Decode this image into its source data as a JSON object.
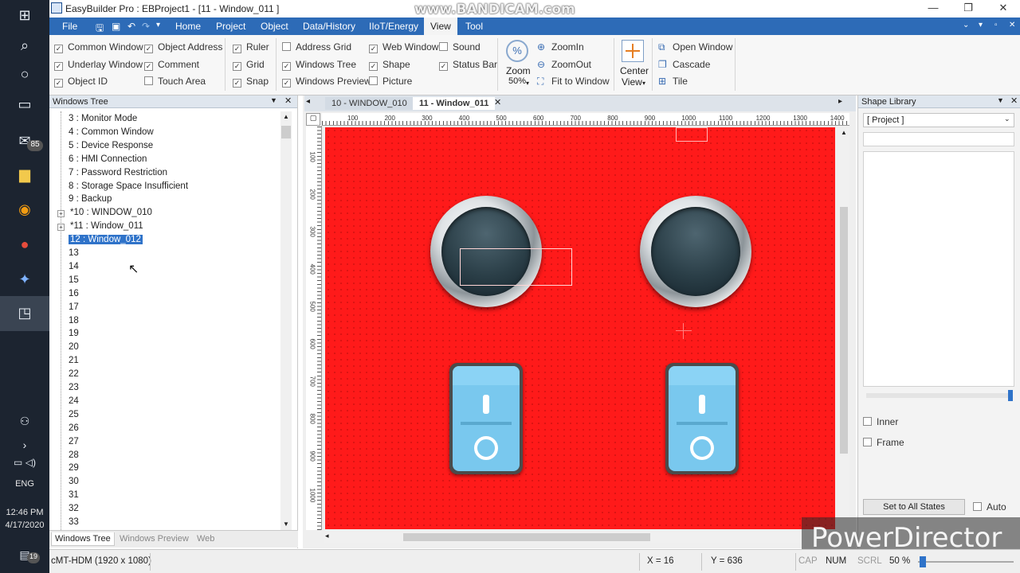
{
  "window": {
    "title": "EasyBuilder Pro : EBProject1 - [11 - Window_011 ]",
    "controls": [
      "—",
      "❐",
      "✕"
    ]
  },
  "watermarks": {
    "top": "www.BANDICAM.com",
    "bottom": "PowerDirector"
  },
  "taskbar": {
    "mail_badge": "85",
    "notif_badge": "19",
    "language": "ENG",
    "time": "12:46 PM",
    "date": "4/17/2020"
  },
  "menubar": {
    "items": [
      "File",
      "Home",
      "Project",
      "Object",
      "Data/History",
      "IIoT/Energy",
      "View",
      "Tool"
    ],
    "active": "View",
    "right_controls": [
      "⌄",
      "▾",
      "▫",
      "✕"
    ]
  },
  "ribbon": {
    "group1": [
      {
        "label": "Common Window",
        "checked": true
      },
      {
        "label": "Underlay Window",
        "checked": true
      },
      {
        "label": "Object ID",
        "checked": true
      },
      {
        "label": "Object Address",
        "checked": true
      },
      {
        "label": "Comment",
        "checked": true
      },
      {
        "label": "Touch Area",
        "checked": false
      }
    ],
    "group2": [
      {
        "label": "Ruler",
        "checked": true
      },
      {
        "label": "Grid",
        "checked": true
      },
      {
        "label": "Snap",
        "checked": true
      }
    ],
    "group3": [
      {
        "label": "Address Grid",
        "checked": false
      },
      {
        "label": "Windows Tree",
        "checked": true
      },
      {
        "label": "Windows Preview",
        "checked": true
      },
      {
        "label": "Web Window",
        "checked": true
      },
      {
        "label": "Shape",
        "checked": true
      },
      {
        "label": "Picture",
        "checked": false
      },
      {
        "label": "Sound",
        "checked": false
      },
      {
        "label": "Status Bar",
        "checked": true
      }
    ],
    "zoom": {
      "label": "Zoom",
      "value": "50%",
      "zoom_in": "ZoomIn",
      "zoom_out": "ZoomOut",
      "fit": "Fit to Window"
    },
    "center_view": {
      "line1": "Center",
      "line2": "View"
    },
    "window_cmds": {
      "open": "Open Window",
      "cascade": "Cascade",
      "tile": "Tile"
    }
  },
  "left_panel": {
    "title": "Windows Tree",
    "items": [
      {
        "label": "3 : Monitor Mode",
        "expand": false
      },
      {
        "label": "4 : Common Window",
        "expand": false
      },
      {
        "label": "5 : Device Response",
        "expand": false
      },
      {
        "label": "6 : HMI Connection",
        "expand": false
      },
      {
        "label": "7 : Password Restriction",
        "expand": false
      },
      {
        "label": "8 : Storage Space Insufficient",
        "expand": false
      },
      {
        "label": "9 : Backup",
        "expand": false
      },
      {
        "label": "*10 : WINDOW_010",
        "expand": true
      },
      {
        "label": "*11 : Window_011",
        "expand": true
      },
      {
        "label": "12 : Window_012",
        "expand": false,
        "selected": true
      },
      {
        "label": "13"
      },
      {
        "label": "14"
      },
      {
        "label": "15"
      },
      {
        "label": "16"
      },
      {
        "label": "17"
      },
      {
        "label": "18"
      },
      {
        "label": "19"
      },
      {
        "label": "20"
      },
      {
        "label": "21"
      },
      {
        "label": "22"
      },
      {
        "label": "23"
      },
      {
        "label": "24"
      },
      {
        "label": "25"
      },
      {
        "label": "26"
      },
      {
        "label": "27"
      },
      {
        "label": "28"
      },
      {
        "label": "29"
      },
      {
        "label": "30"
      },
      {
        "label": "31"
      },
      {
        "label": "32"
      },
      {
        "label": "33"
      }
    ],
    "tabs": [
      "Windows Tree",
      "Windows Preview",
      "Web"
    ],
    "active_tab": "Windows Tree"
  },
  "editor": {
    "tabs": [
      {
        "label": "10 - WINDOW_010",
        "active": false
      },
      {
        "label": "11 - Window_011",
        "active": true
      }
    ],
    "ruler_h": [
      "100",
      "200",
      "300",
      "400",
      "500",
      "600",
      "700",
      "800",
      "900",
      "1000",
      "1100",
      "1200",
      "1300",
      "1400"
    ],
    "ruler_v": [
      "100",
      "200",
      "300",
      "400",
      "500",
      "600",
      "700",
      "800",
      "900",
      "1000"
    ],
    "canvas_color": "#ff1a1a"
  },
  "right_panel": {
    "title": "Shape Library",
    "dropdown": "[ Project ]",
    "inner": "Inner",
    "frame": "Frame",
    "set_all": "Set to All States",
    "auto": "Auto"
  },
  "status": {
    "device": "cMT-HDM (1920 x 1080)",
    "x": "X = 16",
    "y": "Y = 636",
    "caps": "CAP",
    "num": "NUM",
    "scrl": "SCRL",
    "zoom": "50 %"
  }
}
